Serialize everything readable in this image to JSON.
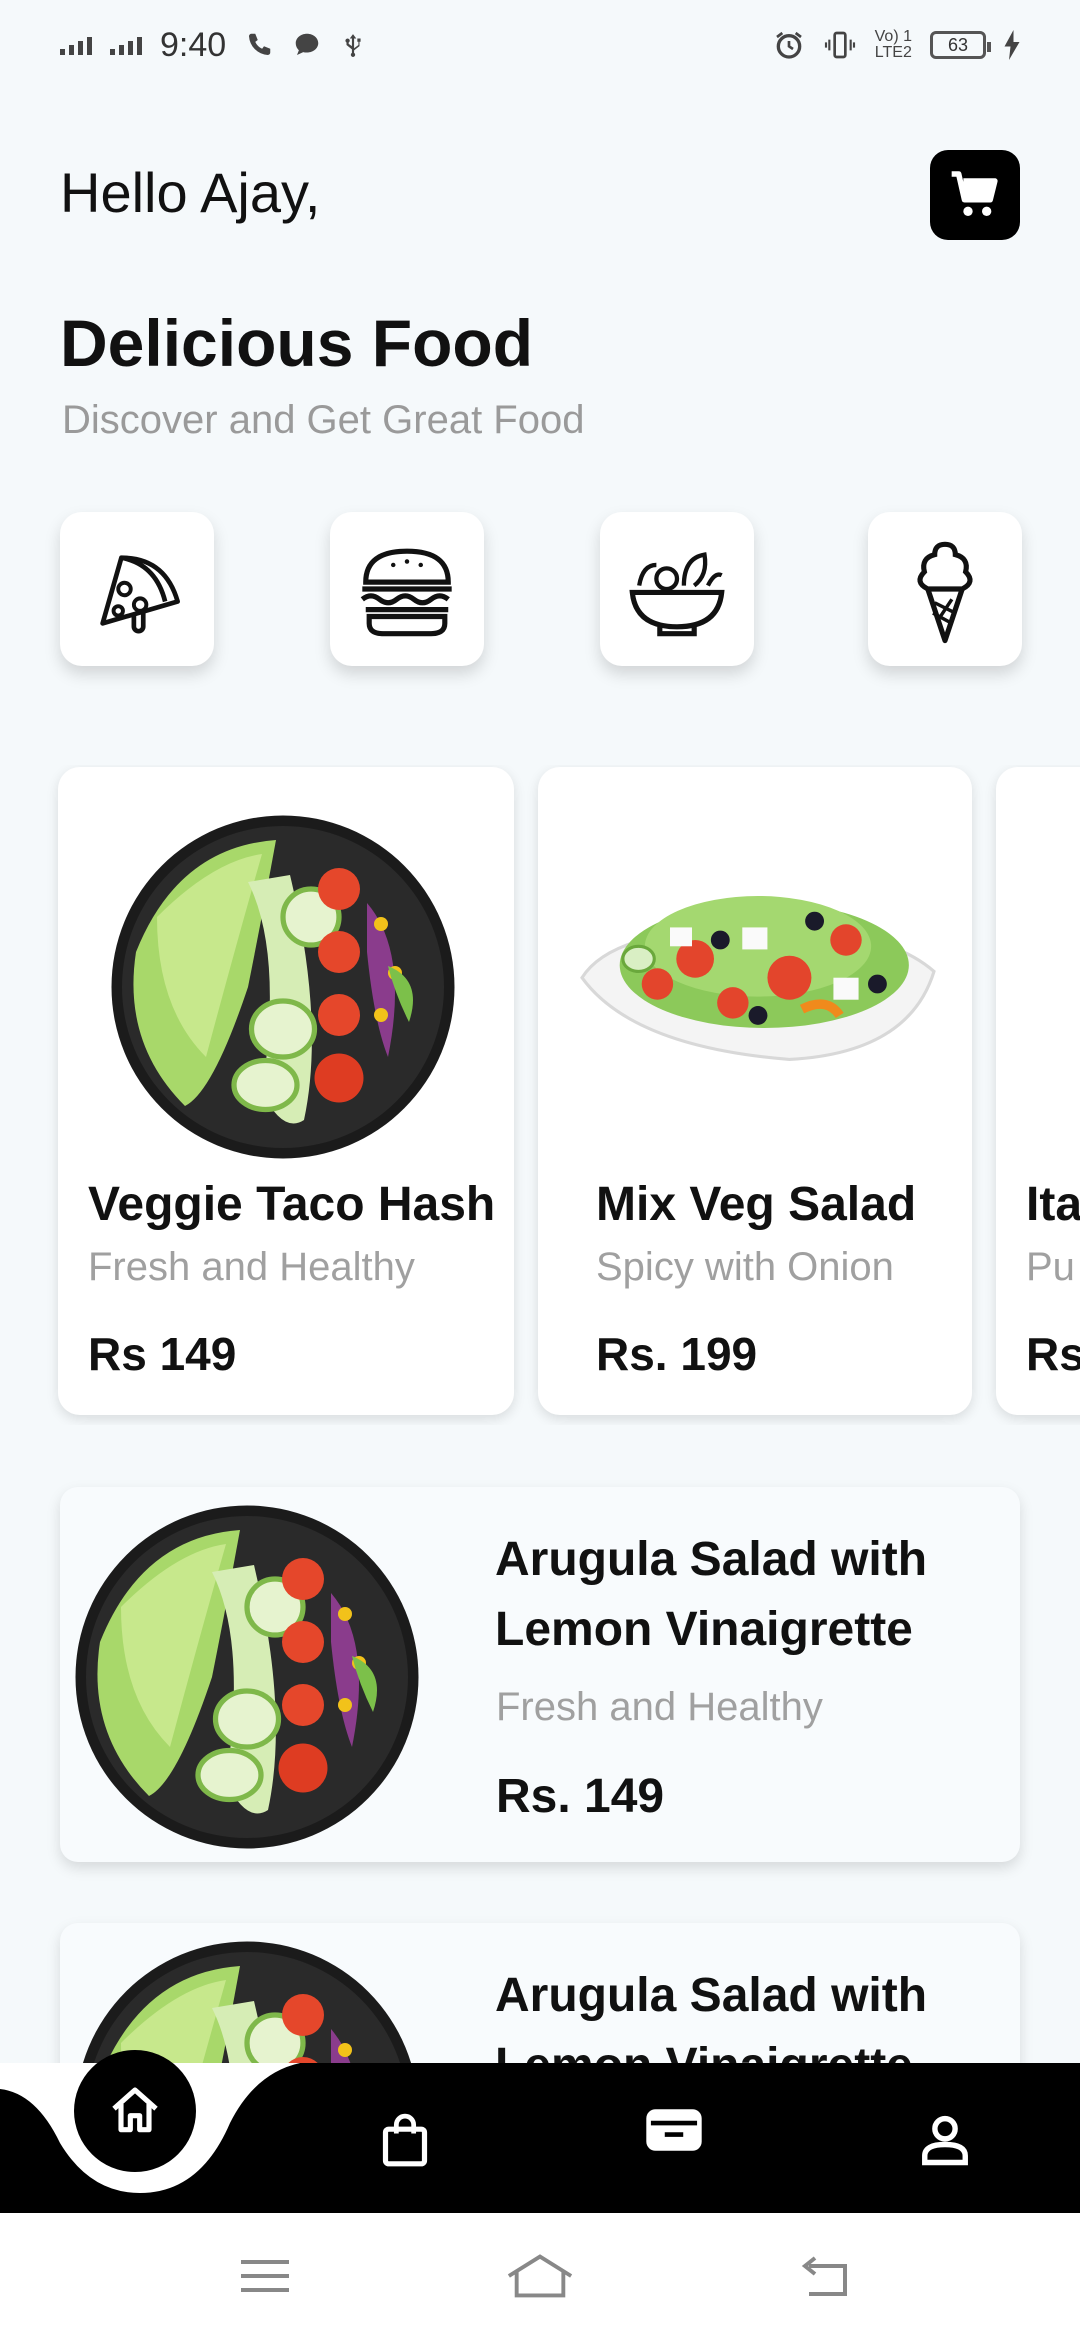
{
  "status_bar": {
    "time": "9:40",
    "lte_line1": "Vo) 1",
    "lte_line2": "LTE2",
    "battery": "63"
  },
  "header": {
    "greeting": "Hello Ajay,",
    "title": "Delicious Food",
    "subtitle": "Discover and Get Great Food"
  },
  "categories": [
    {
      "icon": "pizza-icon"
    },
    {
      "icon": "burger-icon"
    },
    {
      "icon": "salad-bowl-icon"
    },
    {
      "icon": "ice-cream-icon"
    }
  ],
  "featured": [
    {
      "name": "Veggie Taco Hash",
      "desc": "Fresh and Healthy",
      "price": "Rs 149"
    },
    {
      "name": "Mix Veg Salad",
      "desc": "Spicy with Onion",
      "price": "Rs. 199"
    },
    {
      "name": "Ita",
      "desc": "Pu",
      "price": "Rs"
    }
  ],
  "list": [
    {
      "name": "Arugula Salad with Lemon Vinaigrette",
      "desc": "Fresh and Healthy",
      "price": "Rs. 149"
    },
    {
      "name": "Arugula Salad with Lemon Vinaigrette"
    }
  ],
  "bottom_nav": {
    "items": [
      "home-icon",
      "shopping-bag-icon",
      "wallet-icon",
      "profile-icon"
    ],
    "active": "home-icon"
  },
  "system_nav": {
    "items": [
      "menu-icon",
      "home-outline-icon",
      "back-icon"
    ]
  }
}
